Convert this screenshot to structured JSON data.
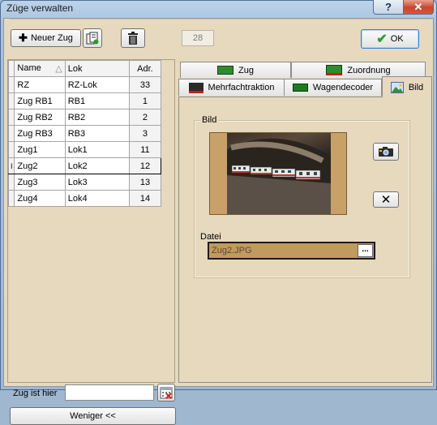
{
  "window": {
    "title": "Züge verwalten",
    "help_label": "?",
    "close_label": "✕"
  },
  "toolbar": {
    "new_train_label": "Neuer Zug",
    "count_value": "28",
    "ok_label": "OK"
  },
  "grid": {
    "columns": {
      "name": "Name",
      "lok": "Lok",
      "adr": "Adr."
    },
    "rows": [
      {
        "name": "RZ",
        "lok": "RZ-Lok",
        "adr": "33"
      },
      {
        "name": "Zug RB1",
        "lok": "RB1",
        "adr": "1"
      },
      {
        "name": "Zug RB2",
        "lok": "RB2",
        "adr": "2"
      },
      {
        "name": "Zug RB3",
        "lok": "RB3",
        "adr": "3"
      },
      {
        "name": "Zug1",
        "lok": "Lok1",
        "adr": "11"
      },
      {
        "name": "Zug2",
        "lok": "Lok2",
        "adr": "12",
        "selected": true
      },
      {
        "name": "Zug3",
        "lok": "Lok3",
        "adr": "13"
      },
      {
        "name": "Zug4",
        "lok": "Lok4",
        "adr": "14"
      }
    ]
  },
  "location": {
    "label": "Zug ist hier",
    "value": ""
  },
  "less_button": "Weniger <<",
  "tabs": {
    "zug": "Zug",
    "zuordnung": "Zuordnung",
    "mehrfachtraktion": "Mehrfachtraktion",
    "wagendecoder": "Wagendecoder",
    "bild": "Bild"
  },
  "bild": {
    "group_label": "Bild",
    "file_label": "Datei",
    "file_value": "Zug2.JPG",
    "browse_label": "..."
  }
}
